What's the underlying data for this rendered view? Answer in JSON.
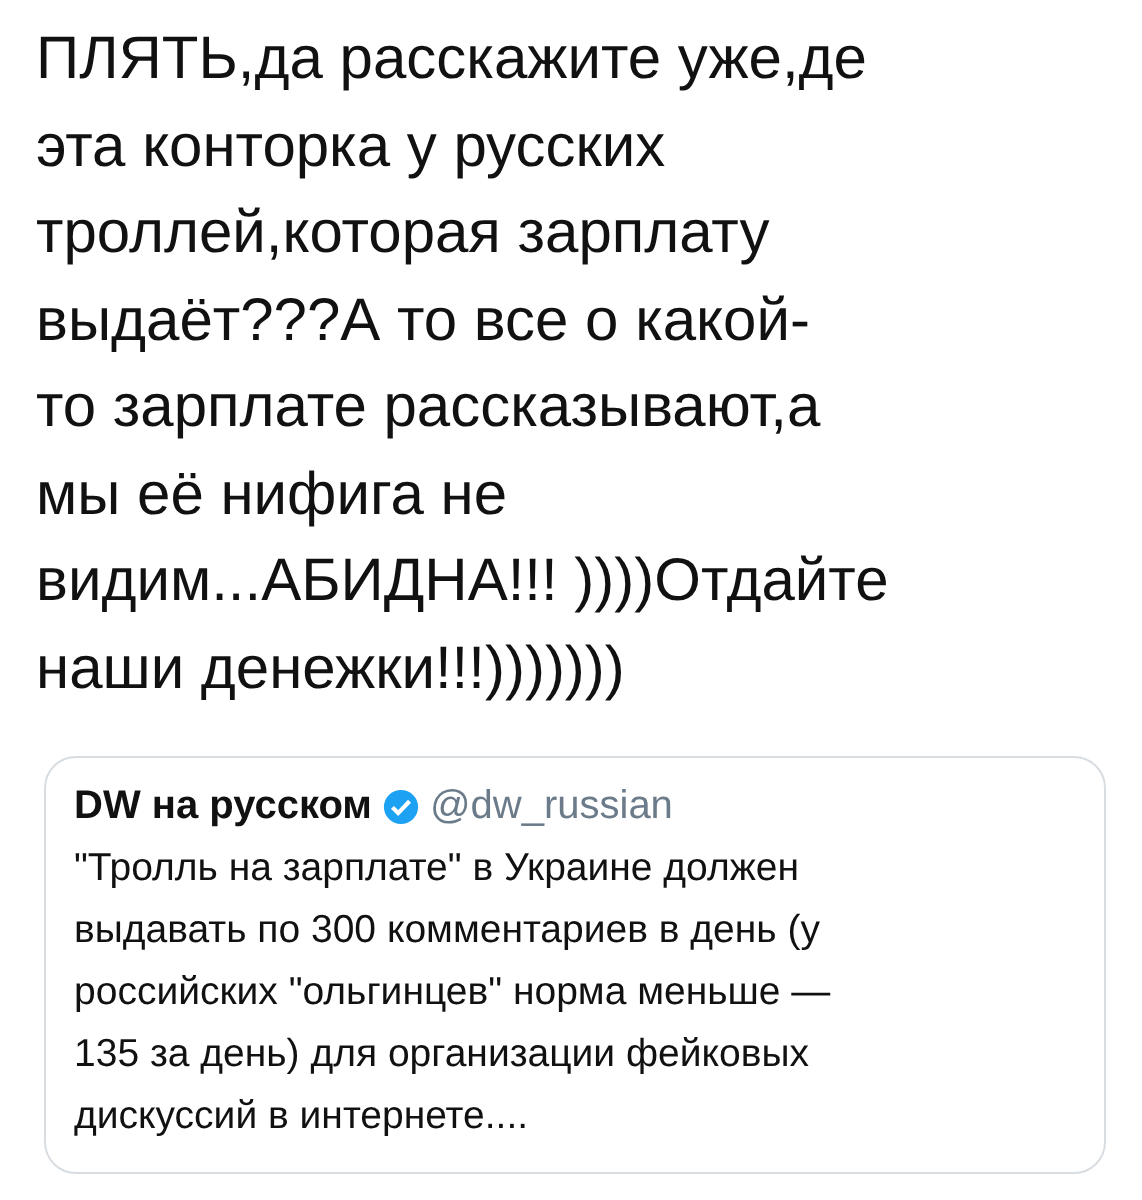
{
  "tweet": {
    "text_lines": [
      "ПЛЯТЬ,да расскажите уже,де",
      "эта конторка у русских",
      "троллей,которая зарплату",
      "выдаёт???А то все о какой-",
      "то зарплате рассказывают,а",
      "мы её нифига не",
      "видим...АБИДНА!!! ))))Отдайте",
      "наши денежки!!!)))))))"
    ]
  },
  "quoted_tweet": {
    "author": "DW на русском",
    "verified": true,
    "handle": "@dw_russian",
    "text_lines": [
      "\"Тролль на зарплате\" в Украине должен",
      "выдавать по 300 комментариев в день (у",
      "российских \"ольгинцев\" норма меньше —",
      "135 за день) для организации фейковых",
      "дискуссий в интернете...."
    ]
  }
}
